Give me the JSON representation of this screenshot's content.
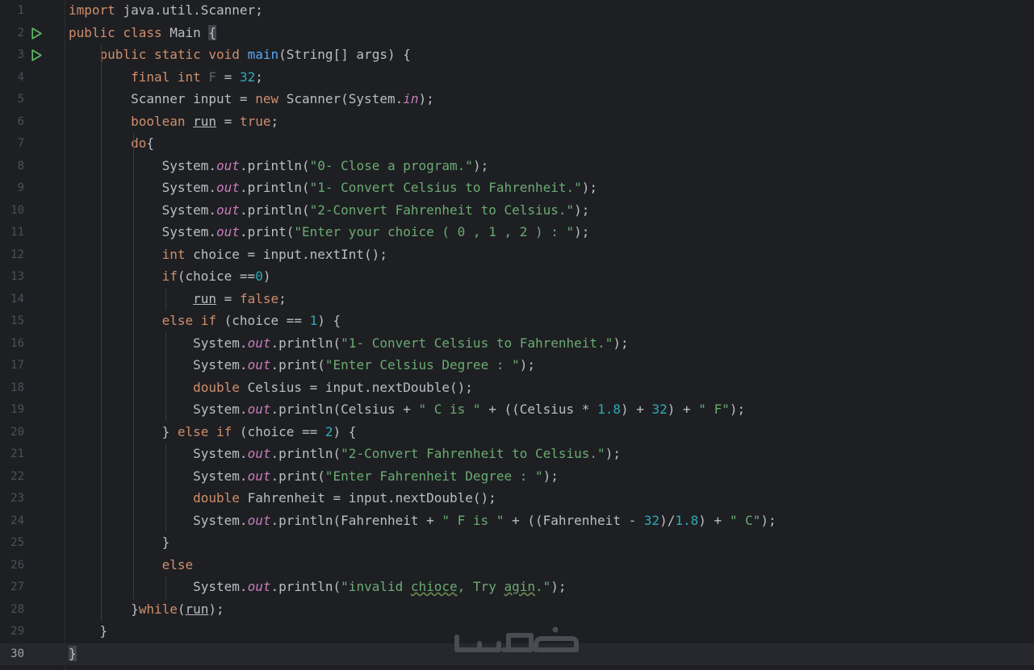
{
  "editor": {
    "current_line": 30,
    "lines": [
      {
        "n": "1",
        "tokens": [
          [
            "kw",
            "import"
          ],
          [
            "t",
            " java.util.Scanner;"
          ]
        ]
      },
      {
        "n": "2",
        "run": true,
        "tokens": [
          [
            "kw",
            "public class "
          ],
          [
            "t",
            "Main "
          ],
          [
            "bh",
            "{"
          ]
        ]
      },
      {
        "n": "3",
        "run": true,
        "tokens": [
          [
            "t",
            "    "
          ],
          [
            "kw",
            "public static void "
          ],
          [
            "fn",
            "main"
          ],
          [
            "t",
            "(String[] args) {"
          ]
        ]
      },
      {
        "n": "4",
        "tokens": [
          [
            "t",
            "        "
          ],
          [
            "kw",
            "final int "
          ],
          [
            "const",
            "F"
          ],
          [
            "t",
            " = "
          ],
          [
            "num",
            "32"
          ],
          [
            "t",
            ";"
          ]
        ]
      },
      {
        "n": "5",
        "tokens": [
          [
            "t",
            "        Scanner input = "
          ],
          [
            "kw",
            "new "
          ],
          [
            "t",
            "Scanner(System."
          ],
          [
            "st",
            "in"
          ],
          [
            "t",
            ");"
          ]
        ]
      },
      {
        "n": "6",
        "tokens": [
          [
            "t",
            "        "
          ],
          [
            "kw",
            "boolean "
          ],
          [
            "ul",
            "run"
          ],
          [
            "t",
            " = "
          ],
          [
            "kw",
            "true"
          ],
          [
            "t",
            ";"
          ]
        ]
      },
      {
        "n": "7",
        "tokens": [
          [
            "t",
            "        "
          ],
          [
            "kw",
            "do"
          ],
          [
            "t",
            "{"
          ]
        ]
      },
      {
        "n": "8",
        "tokens": [
          [
            "t",
            "            System."
          ],
          [
            "st",
            "out"
          ],
          [
            "t",
            ".println("
          ],
          [
            "str",
            "\"0- Close a program.\""
          ],
          [
            "t",
            ");"
          ]
        ]
      },
      {
        "n": "9",
        "tokens": [
          [
            "t",
            "            System."
          ],
          [
            "st",
            "out"
          ],
          [
            "t",
            ".println("
          ],
          [
            "str",
            "\"1- Convert Celsius to Fahrenheit.\""
          ],
          [
            "t",
            ");"
          ]
        ]
      },
      {
        "n": "10",
        "tokens": [
          [
            "t",
            "            System."
          ],
          [
            "st",
            "out"
          ],
          [
            "t",
            ".println("
          ],
          [
            "str",
            "\"2-Convert Fahrenheit to Celsius.\""
          ],
          [
            "t",
            ");"
          ]
        ]
      },
      {
        "n": "11",
        "tokens": [
          [
            "t",
            "            System."
          ],
          [
            "st",
            "out"
          ],
          [
            "t",
            ".print("
          ],
          [
            "str",
            "\"Enter your choice ( 0 , 1 , 2 ) : \""
          ],
          [
            "t",
            ");"
          ]
        ]
      },
      {
        "n": "12",
        "tokens": [
          [
            "t",
            "            "
          ],
          [
            "kw",
            "int "
          ],
          [
            "t",
            "choice = input.nextInt();"
          ]
        ]
      },
      {
        "n": "13",
        "tokens": [
          [
            "t",
            "            "
          ],
          [
            "kw",
            "if"
          ],
          [
            "t",
            "(choice =="
          ],
          [
            "num",
            "0"
          ],
          [
            "t",
            ")"
          ]
        ]
      },
      {
        "n": "14",
        "tokens": [
          [
            "t",
            "                "
          ],
          [
            "ul",
            "run"
          ],
          [
            "t",
            " = "
          ],
          [
            "kw",
            "false"
          ],
          [
            "t",
            ";"
          ]
        ]
      },
      {
        "n": "15",
        "tokens": [
          [
            "t",
            "            "
          ],
          [
            "kw",
            "else if "
          ],
          [
            "t",
            "(choice == "
          ],
          [
            "num",
            "1"
          ],
          [
            "t",
            ") {"
          ]
        ]
      },
      {
        "n": "16",
        "tokens": [
          [
            "t",
            "                System."
          ],
          [
            "st",
            "out"
          ],
          [
            "t",
            ".println("
          ],
          [
            "str",
            "\"1- Convert Celsius to Fahrenheit.\""
          ],
          [
            "t",
            ");"
          ]
        ]
      },
      {
        "n": "17",
        "tokens": [
          [
            "t",
            "                System."
          ],
          [
            "st",
            "out"
          ],
          [
            "t",
            ".print("
          ],
          [
            "str",
            "\"Enter Celsius Degree : \""
          ],
          [
            "t",
            ");"
          ]
        ]
      },
      {
        "n": "18",
        "tokens": [
          [
            "t",
            "                "
          ],
          [
            "kw",
            "double "
          ],
          [
            "t",
            "Celsius = input.nextDouble();"
          ]
        ]
      },
      {
        "n": "19",
        "tokens": [
          [
            "t",
            "                System."
          ],
          [
            "st",
            "out"
          ],
          [
            "t",
            ".println(Celsius + "
          ],
          [
            "str",
            "\" C is \""
          ],
          [
            "t",
            " + ((Celsius * "
          ],
          [
            "num",
            "1.8"
          ],
          [
            "t",
            ") + "
          ],
          [
            "num",
            "32"
          ],
          [
            "t",
            ") + "
          ],
          [
            "str",
            "\" F\""
          ],
          [
            "t",
            ");"
          ]
        ]
      },
      {
        "n": "20",
        "tokens": [
          [
            "t",
            "            } "
          ],
          [
            "kw",
            "else if "
          ],
          [
            "t",
            "(choice == "
          ],
          [
            "num",
            "2"
          ],
          [
            "t",
            ") {"
          ]
        ]
      },
      {
        "n": "21",
        "tokens": [
          [
            "t",
            "                System."
          ],
          [
            "st",
            "out"
          ],
          [
            "t",
            ".println("
          ],
          [
            "str",
            "\"2-Convert Fahrenheit to Celsius.\""
          ],
          [
            "t",
            ");"
          ]
        ]
      },
      {
        "n": "22",
        "tokens": [
          [
            "t",
            "                System."
          ],
          [
            "st",
            "out"
          ],
          [
            "t",
            ".print("
          ],
          [
            "str",
            "\"Enter Fahrenheit Degree : \""
          ],
          [
            "t",
            ");"
          ]
        ]
      },
      {
        "n": "23",
        "tokens": [
          [
            "t",
            "                "
          ],
          [
            "kw",
            "double "
          ],
          [
            "t",
            "Fahrenheit = input.nextDouble();"
          ]
        ]
      },
      {
        "n": "24",
        "tokens": [
          [
            "t",
            "                System."
          ],
          [
            "st",
            "out"
          ],
          [
            "t",
            ".println(Fahrenheit + "
          ],
          [
            "str",
            "\" F is \""
          ],
          [
            "t",
            " + ((Fahrenheit - "
          ],
          [
            "num",
            "32"
          ],
          [
            "t",
            ")/"
          ],
          [
            "num",
            "1.8"
          ],
          [
            "t",
            ") + "
          ],
          [
            "str",
            "\" C\""
          ],
          [
            "t",
            ");"
          ]
        ]
      },
      {
        "n": "25",
        "tokens": [
          [
            "t",
            "            }"
          ]
        ]
      },
      {
        "n": "26",
        "tokens": [
          [
            "t",
            "            "
          ],
          [
            "kw",
            "else"
          ]
        ]
      },
      {
        "n": "27",
        "tokens": [
          [
            "t",
            "                System."
          ],
          [
            "st",
            "out"
          ],
          [
            "t",
            ".println("
          ],
          [
            "str",
            "\"invalid "
          ],
          [
            "typo",
            "chioce"
          ],
          [
            "str",
            ", Try "
          ],
          [
            "typo",
            "agin"
          ],
          [
            "str",
            ".\""
          ],
          [
            "t",
            ");"
          ]
        ]
      },
      {
        "n": "28",
        "tokens": [
          [
            "t",
            "        }"
          ],
          [
            "kw",
            "while"
          ],
          [
            "t",
            "("
          ],
          [
            "ul",
            "run"
          ],
          [
            "t",
            ");"
          ]
        ]
      },
      {
        "n": "29",
        "tokens": [
          [
            "t",
            "    }"
          ]
        ]
      },
      {
        "n": "30",
        "tokens": [
          [
            "bh",
            "}"
          ]
        ]
      }
    ]
  },
  "watermark": {
    "icon": "khamsat-logo",
    "text": "خمسات"
  },
  "colors": {
    "background": "#1e1f22",
    "current_line": "#26282e",
    "keyword": "#cf8e6d",
    "string": "#6aab73",
    "number": "#2aacb8",
    "method": "#56a8f5",
    "static_field": "#c77dbb",
    "plain": "#bcbec4",
    "line_number": "#4b5059",
    "run_icon": "#5fb865"
  }
}
